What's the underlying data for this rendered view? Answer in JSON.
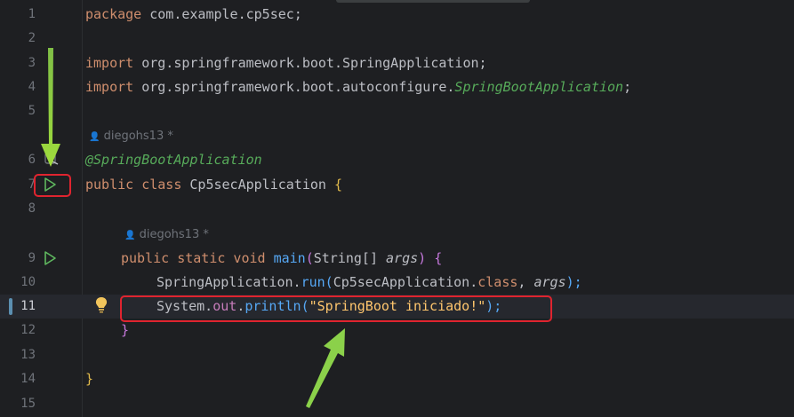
{
  "editor": {
    "line_numbers": [
      "1",
      "2",
      "3",
      "4",
      "5",
      "6",
      "7",
      "8",
      "9",
      "10",
      "11",
      "12",
      "13",
      "14",
      "15"
    ],
    "author_hints": [
      "diegohs13 *",
      "diegohs13 *"
    ],
    "code": {
      "l1_kw": "package",
      "l1_rest": " com.example.cp5sec;",
      "l3_kw": "import",
      "l3_rest": " org.springframework.boot.SpringApplication;",
      "l4_kw": "import",
      "l4_rest": " org.springframework.boot.autoconfigure.",
      "l4_italic": "SpringBootApplication",
      "l4_end": ";",
      "l6_annotation": "@SpringBootApplication",
      "l7_kw": "public class",
      "l7_name": " Cp5secApplication ",
      "l7_brace": "{",
      "l9_kw": "public static void",
      "l9_fn": " main",
      "l9_open": "(",
      "l9_type": "String[] ",
      "l9_param": "args",
      "l9_close": ")",
      "l9_brace": " {",
      "l10_cls": "SpringApplication.",
      "l10_fn": "run",
      "l10_open": "(",
      "l10_arg": "Cp5secApplication.",
      "l10_kw": "class",
      "l10_comma": ", ",
      "l10_param": "args",
      "l10_close": ");",
      "l11_cls": "System.",
      "l11_field": "out",
      "l11_dot": ".",
      "l11_fn": "println",
      "l11_open": "(",
      "l11_str": "\"SpringBoot iniciado!\"",
      "l11_close": ");",
      "l12_brace": "}",
      "l14_brace": "}"
    },
    "current_line": "11"
  },
  "colors": {
    "background": "#1e1f22",
    "keyword": "#cf8e6d",
    "annotation": "#57ab5a",
    "run_icon": "#5fb85f",
    "highlight_box": "#e0242f",
    "arrow": "#8bd14a"
  },
  "icons": {
    "run_gutter": "play-triangle-icon",
    "intention": "lightbulb-icon"
  }
}
